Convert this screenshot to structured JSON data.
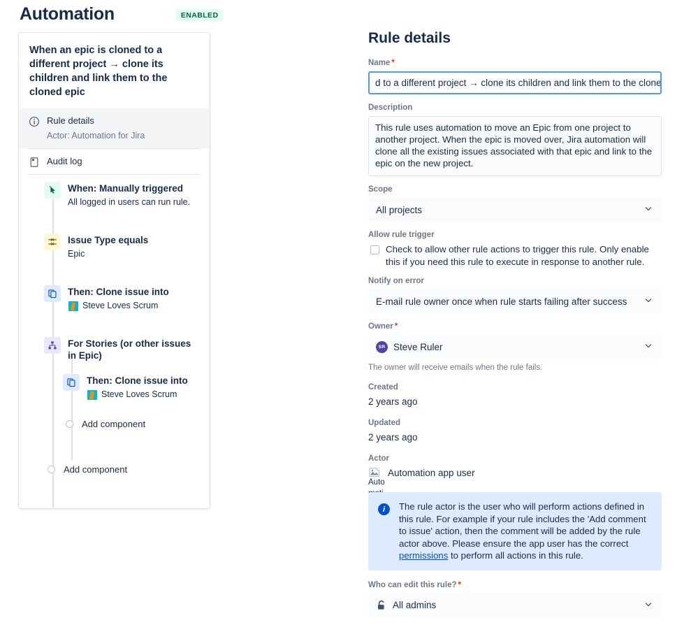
{
  "header": {
    "title": "Automation",
    "status_badge": "ENABLED",
    "badge_bg": "#e3fcef",
    "badge_fg": "#006644"
  },
  "rule_card": {
    "title": "When an epic is cloned to a different project → clone its children and link them to the cloned epic",
    "nav": [
      {
        "icon": "info-circle-icon",
        "label": "Rule details",
        "sub": "Actor: Automation for Jira",
        "selected": true
      },
      {
        "icon": "audit-log-icon",
        "label": "Audit log",
        "sub": "",
        "selected": false
      }
    ],
    "steps": [
      {
        "icon": "cursor-click-icon",
        "icon_color": "green",
        "title": "When: Manually triggered",
        "sub": "All logged in users can run rule.",
        "sub_avatar": false,
        "indented": false
      },
      {
        "icon": "condition-filter-icon",
        "icon_color": "yellow",
        "title": "Issue Type equals",
        "sub": "Epic",
        "sub_avatar": false,
        "indented": false
      },
      {
        "icon": "clone-copy-icon",
        "icon_color": "blue",
        "title": "Then: Clone issue into",
        "sub": "Steve Loves Scrum",
        "sub_avatar": true,
        "indented": false
      },
      {
        "icon": "branch-hierarchy-icon",
        "icon_color": "purple",
        "title": "For Stories (or other issues in Epic)",
        "sub": "",
        "sub_avatar": false,
        "indented": false
      },
      {
        "icon": "clone-copy-icon",
        "icon_color": "blue",
        "title": "Then: Clone issue into",
        "sub": "Steve Loves Scrum",
        "sub_avatar": true,
        "indented": true
      }
    ],
    "add_component_branch": "Add component",
    "add_component_root": "Add component"
  },
  "detail": {
    "title": "Rule details",
    "name": {
      "label": "Name",
      "required": true,
      "value": "d to a different project → clone its children and link them to the cloned",
      "selection_marker": "•••",
      "selection_color": "#de350b"
    },
    "description": {
      "label": "Description",
      "value": "This rule uses automation to move an Epic from one project to another project. When the epic is moved over, Jira automation will clone all the existing issues associated with that epic and link to the epic on the new project."
    },
    "scope": {
      "label": "Scope",
      "value": "All projects"
    },
    "allow_rule_trigger": {
      "label": "Allow rule trigger",
      "checkbox_checked": false,
      "text": "Check to allow other rule actions to trigger this rule. Only enable this if you need this rule to execute in response to another rule."
    },
    "notify_on_error": {
      "label": "Notify on error",
      "value": "E-mail rule owner once when rule starts failing after success"
    },
    "owner": {
      "label": "Owner",
      "required": true,
      "value": "Steve Ruler",
      "avatar_initials": "SR",
      "avatar_color": "#5243aa",
      "helper": "The owner will receive emails when the rule fails."
    },
    "created": {
      "label": "Created",
      "value": "2 years ago"
    },
    "updated": {
      "label": "Updated",
      "value": "2 years ago"
    },
    "actor": {
      "label": "Actor",
      "value": "Automation app user",
      "broken_image_alt": "Automation app user"
    },
    "info_panel": {
      "text_before_link": "The rule actor is the user who will perform actions defined in this rule. For example if your rule includes the 'Add comment to issue' action, then the comment will be added by the rule actor above. Please ensure the app user has the correct ",
      "link_text": "permissions",
      "text_after_link": " to perform all actions in this rule."
    },
    "who_can_edit": {
      "label": "Who can edit this rule?",
      "required": true,
      "value": "All admins",
      "icon": "lock-icon"
    }
  }
}
